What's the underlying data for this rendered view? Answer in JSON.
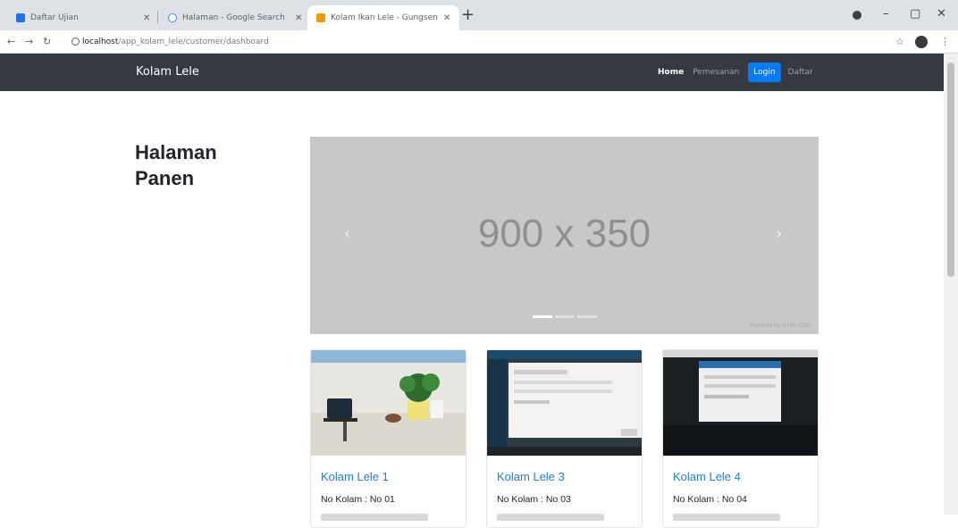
{
  "browser": {
    "tabs": [
      {
        "title": "Daftar Ujian",
        "favicon_color": "#1a73e8"
      },
      {
        "title": "Halaman - Google Search",
        "favicon_color": "#4285f4"
      },
      {
        "title": "Kolam Ikan Lele - Gungseng",
        "favicon_color": "#f29900",
        "active": true
      }
    ],
    "url_host": "localhost",
    "url_path": "/app_kolam_lele/customer/dashboard"
  },
  "navbar": {
    "brand": "Kolam Lele",
    "links": {
      "home": "Home",
      "pemesanan": "Pemesanan",
      "login": "Login",
      "daftar": "Daftar"
    }
  },
  "page": {
    "heading": "Halaman Panen",
    "carousel": {
      "placeholder": "900 x 350",
      "prev_icon": "‹",
      "next_icon": "›",
      "credit": "Powered by HTML.COM"
    },
    "cards": [
      {
        "title": "Kolam Lele 1",
        "no_kolam": "No Kolam : No 01"
      },
      {
        "title": "Kolam Lele 3",
        "no_kolam": "No Kolam : No 03"
      },
      {
        "title": "Kolam Lele 4",
        "no_kolam": "No Kolam : No 04"
      }
    ]
  },
  "colors": {
    "navbar_bg": "#343a40",
    "login_button": "#007bff",
    "card_title": "#1f7fd0",
    "carousel_bg": "#c8c8c8"
  }
}
